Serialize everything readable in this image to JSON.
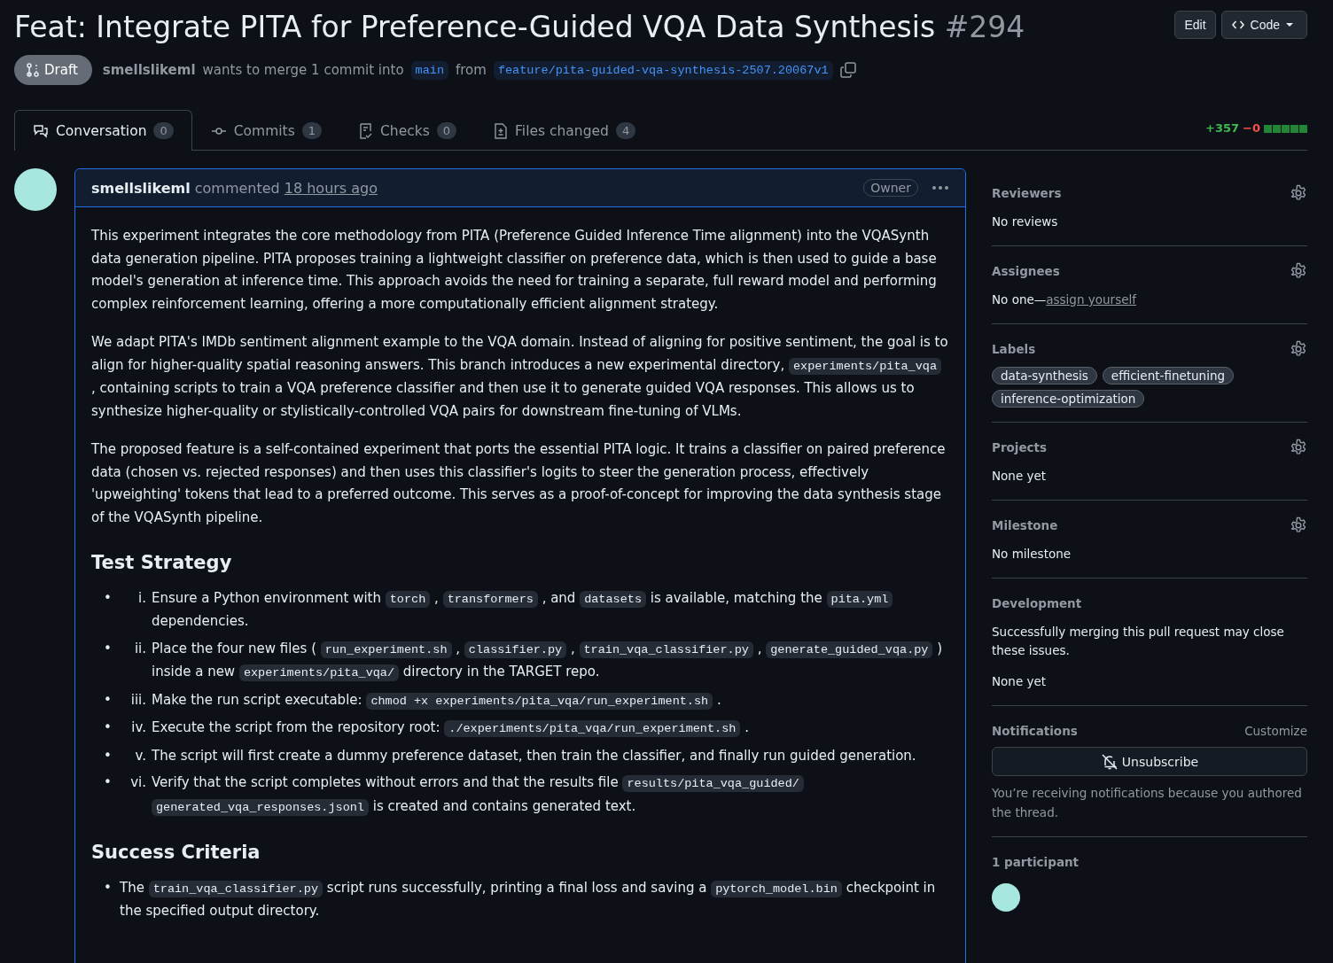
{
  "header": {
    "title": "Feat: Integrate PITA for Preference-Guided VQA Data Synthesis",
    "number": "#294",
    "edit_button": "Edit",
    "code_button": "Code",
    "status": "Draft",
    "author": "smellslikeml",
    "merge_text": "wants to merge 1 commit into",
    "base_branch": "main",
    "from_text": "from",
    "head_branch": "feature/pita-guided-vqa-synthesis-2507.20067v1"
  },
  "tabs": [
    {
      "label": "Conversation",
      "count": "0",
      "selected": true
    },
    {
      "label": "Commits",
      "count": "1",
      "selected": false
    },
    {
      "label": "Checks",
      "count": "0",
      "selected": false
    },
    {
      "label": "Files changed",
      "count": "4",
      "selected": false
    }
  ],
  "diffstat": {
    "added": "+357",
    "removed": "−0",
    "blocks": [
      {
        "color": "#238636"
      },
      {
        "color": "#238636"
      },
      {
        "color": "#238636"
      },
      {
        "color": "#238636"
      },
      {
        "color": "#238636"
      }
    ]
  },
  "comment": {
    "author": "smellslikeml",
    "action": "commented",
    "time": "18 hours ago",
    "role": "Owner",
    "body": [
      {
        "kind": "paragraph",
        "parts": [
          {
            "kind": "text",
            "text": "This experiment integrates the core methodology from PITA (Preference Guided Inference Time alignment) into the VQASynth data generation pipeline. PITA proposes training a lightweight classifier on preference data, which is then used to guide a base model's generation at inference time. This approach avoids the need for training a separate, full reward model and performing complex reinforcement learning, offering a more computationally efficient alignment strategy."
          }
        ]
      },
      {
        "kind": "paragraph",
        "parts": [
          {
            "kind": "text",
            "text": "We adapt PITA's IMDb sentiment alignment example to the VQA domain. Instead of aligning for positive sentiment, the goal is to align for higher-quality spatial reasoning answers. This branch introduces a new experimental directory,"
          },
          {
            "kind": "code",
            "text": "experiments/pita_vqa"
          },
          {
            "kind": "text",
            "text": ", containing scripts to train a VQA preference classifier and then use it to generate guided VQA responses. This allows us to synthesize higher-quality or stylistically-controlled VQA pairs for downstream fine-tuning of VLMs."
          }
        ]
      },
      {
        "kind": "paragraph",
        "parts": [
          {
            "kind": "text",
            "text": "The proposed feature is a self-contained experiment that ports the essential PITA logic. It trains a classifier on paired preference data (chosen vs. rejected responses) and then uses this classifier's logits to steer the generation process, effectively 'upweighting' tokens that lead to a preferred outcome. This serves as a proof-of-concept for improving the data synthesis stage of the VQASynth pipeline."
          }
        ]
      },
      {
        "kind": "heading",
        "text": "Test Strategy"
      },
      {
        "kind": "list",
        "items": [
          {
            "bullet": "•",
            "number": "i.",
            "parts": [
              {
                "kind": "text",
                "text": "Ensure a Python environment with"
              },
              {
                "kind": "code",
                "text": "torch"
              },
              {
                "kind": "text",
                "text": ","
              },
              {
                "kind": "code",
                "text": "transformers"
              },
              {
                "kind": "text",
                "text": ", and"
              },
              {
                "kind": "code",
                "text": "datasets"
              },
              {
                "kind": "text",
                "text": "is available, matching the"
              },
              {
                "kind": "code",
                "text": "pita.yml"
              },
              {
                "kind": "text",
                "text": "dependencies."
              }
            ]
          },
          {
            "bullet": "•",
            "number": "ii.",
            "parts": [
              {
                "kind": "text",
                "text": "Place the four new files ("
              },
              {
                "kind": "code",
                "text": "run_experiment.sh"
              },
              {
                "kind": "text",
                "text": ","
              },
              {
                "kind": "code",
                "text": "classifier.py"
              },
              {
                "kind": "text",
                "text": ","
              },
              {
                "kind": "code",
                "text": "train_vqa_classifier.py"
              },
              {
                "kind": "text",
                "text": ","
              },
              {
                "kind": "code",
                "text": "generate_guided_vqa.py"
              },
              {
                "kind": "text",
                "text": ") inside a new"
              },
              {
                "kind": "code",
                "text": "experiments/pita_vqa/"
              },
              {
                "kind": "text",
                "text": "directory in the TARGET repo."
              }
            ]
          },
          {
            "bullet": "•",
            "number": "iii.",
            "parts": [
              {
                "kind": "text",
                "text": "Make the run script executable:"
              },
              {
                "kind": "code",
                "text": "chmod +x experiments/pita_vqa/run_experiment.sh"
              },
              {
                "kind": "text",
                "text": "."
              }
            ]
          },
          {
            "bullet": "•",
            "number": "iv.",
            "parts": [
              {
                "kind": "text",
                "text": "Execute the script from the repository root:"
              },
              {
                "kind": "code",
                "text": "./experiments/pita_vqa/run_experiment.sh"
              },
              {
                "kind": "text",
                "text": "."
              }
            ]
          },
          {
            "bullet": "•",
            "number": "v.",
            "parts": [
              {
                "kind": "text",
                "text": "The script will first create a dummy preference dataset, then train the classifier, and finally run guided generation."
              }
            ]
          },
          {
            "bullet": "•",
            "number": "vi.",
            "parts": [
              {
                "kind": "text",
                "text": "Verify that the script completes without errors and that the results file"
              },
              {
                "kind": "code",
                "text": "results/pita_vqa_guided/"
              },
              {
                "kind": "code",
                "text": "generated_vqa_responses.jsonl"
              },
              {
                "kind": "text",
                "text": "is created and contains generated text."
              }
            ]
          }
        ]
      },
      {
        "kind": "heading",
        "text": "Success Criteria"
      },
      {
        "kind": "list",
        "items": [
          {
            "bullet": "•",
            "parts": [
              {
                "kind": "text",
                "text": "The"
              },
              {
                "kind": "code",
                "text": "train_vqa_classifier.py"
              },
              {
                "kind": "text",
                "text": "script runs successfully, printing a final loss and saving a"
              },
              {
                "kind": "code",
                "text": "pytorch_model.bin"
              },
              {
                "kind": "text",
                "text": "checkpoint in the specified output directory."
              }
            ]
          }
        ]
      }
    ]
  },
  "sidebar": [
    {
      "kind": "text",
      "title": "Reviewers",
      "has_settings": true,
      "value": "No reviews"
    },
    {
      "kind": "assign",
      "title": "Assignees",
      "has_settings": true,
      "value": "No one—",
      "link": "assign yourself"
    },
    {
      "kind": "labels",
      "title": "Labels",
      "has_settings": true,
      "labels": [
        "data-synthesis",
        "efficient-finetuning",
        "inference-optimization"
      ]
    },
    {
      "kind": "text",
      "title": "Projects",
      "has_settings": true,
      "value": "None yet"
    },
    {
      "kind": "text",
      "title": "Milestone",
      "has_settings": true,
      "value": "No milestone"
    },
    {
      "kind": "development",
      "title": "Development",
      "has_settings": false,
      "description": "Successfully merging this pull request may close these issues.",
      "value": "None yet"
    },
    {
      "kind": "notifications",
      "title": "Notifications",
      "has_settings": false,
      "action": "Customize",
      "button": "Unsubscribe",
      "note": "You’re receiving notifications because you authored the thread."
    },
    {
      "kind": "participants",
      "title": "1 participant",
      "has_settings": false
    }
  ]
}
